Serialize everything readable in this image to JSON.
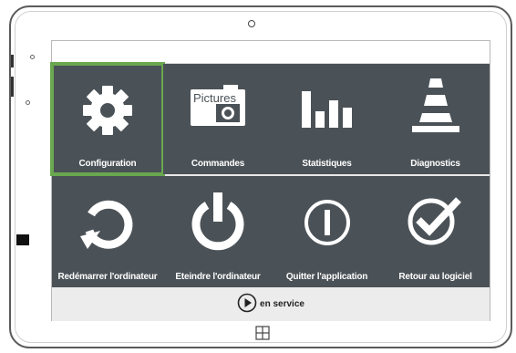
{
  "tiles": [
    {
      "label": "Configuration",
      "icon": "gear-icon"
    },
    {
      "label": "Commandes",
      "icon": "pictures-icon",
      "icon_text": "Pictures"
    },
    {
      "label": "Statistiques",
      "icon": "bar-chart-icon"
    },
    {
      "label": "Diagnostics",
      "icon": "traffic-cone-icon"
    },
    {
      "label": "Redémarrer l'ordinateur",
      "icon": "restart-icon"
    },
    {
      "label": "Eteindre l'ordinateur",
      "icon": "power-icon"
    },
    {
      "label": "Quitter l'application",
      "icon": "exit-icon"
    },
    {
      "label": "Retour au logiciel",
      "icon": "checkmark-icon"
    }
  ],
  "status": {
    "text": "en service",
    "icon": "play-icon"
  },
  "colors": {
    "tile": "#4b5257",
    "selected_outline": "#6aa84f",
    "status_bar": "#ececec"
  },
  "selected_tile": "Configuration"
}
